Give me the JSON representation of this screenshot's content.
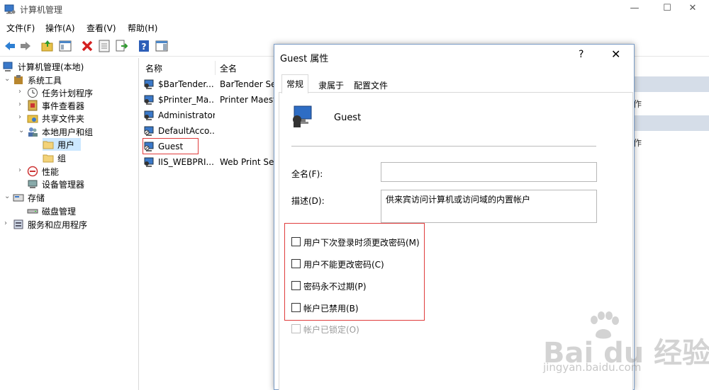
{
  "window": {
    "title": "计算机管理",
    "minimize": "—",
    "maximize": "☐",
    "close": "✕"
  },
  "menu": [
    "文件(F)",
    "操作(A)",
    "查看(V)",
    "帮助(H)"
  ],
  "tree": {
    "root": "计算机管理(本地)",
    "system_tools": "系统工具",
    "task_scheduler": "任务计划程序",
    "event_viewer": "事件查看器",
    "shared_folders": "共享文件夹",
    "local_users_groups": "本地用户和组",
    "users": "用户",
    "groups": "组",
    "performance": "性能",
    "device_manager": "设备管理器",
    "storage": "存储",
    "disk_management": "磁盘管理",
    "services_apps": "服务和应用程序"
  },
  "list": {
    "col_name": "名称",
    "col_fullname": "全名",
    "rows": [
      {
        "name": "$BarTender...",
        "fullname": "BarTender Se"
      },
      {
        "name": "$Printer_Ma...",
        "fullname": "Printer Maest"
      },
      {
        "name": "Administrator",
        "fullname": ""
      },
      {
        "name": "DefaultAcco...",
        "fullname": ""
      },
      {
        "name": "Guest",
        "fullname": ""
      },
      {
        "name": "IIS_WEBPRI...",
        "fullname": "Web Print Ser"
      }
    ]
  },
  "actions_partial": [
    "作",
    "作"
  ],
  "dialog": {
    "title": "Guest 属性",
    "help": "?",
    "close": "✕",
    "tabs": [
      "常规",
      "隶属于",
      "配置文件"
    ],
    "user_name": "Guest",
    "fullname_label": "全名(F):",
    "fullname_value": "",
    "desc_label": "描述(D):",
    "desc_value": "供来宾访问计算机或访问域的内置帐户",
    "checkboxes": [
      "用户下次登录时须更改密码(M)",
      "用户不能更改密码(C)",
      "密码永不过期(P)",
      "帐户已禁用(B)"
    ],
    "locked_checkbox": "帐户已锁定(O)"
  },
  "watermark": {
    "main": "Bai du 经验",
    "sub": "jingyan.baidu.com"
  },
  "colors": {
    "highlight_red": "#e03c3c",
    "selection_blue": "#cce8ff",
    "dialog_border": "#7a9cc6"
  }
}
